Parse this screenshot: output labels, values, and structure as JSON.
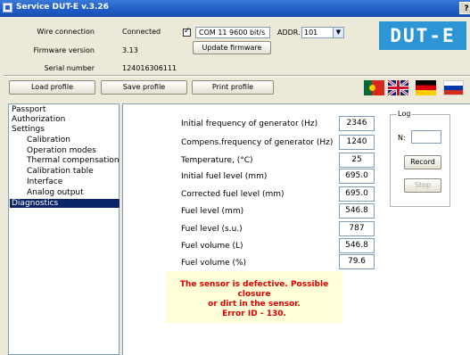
{
  "window": {
    "title": "Service DUT-E  v.3.26",
    "help_label": "?"
  },
  "header": {
    "wire_connection_label": "Wire connection",
    "wire_connection_value": "Connected",
    "firmware_version_label": "Firmware version",
    "firmware_version_value": "3.13",
    "serial_number_label": "Serial number",
    "serial_number_value": "124016306111",
    "com_checked": true,
    "com_value": "COM 11   9600 bit/s",
    "addr_label": "ADDR.",
    "addr_value": "101",
    "update_firmware_label": "Update firmware",
    "logo_text": "DUT-E"
  },
  "toolbar": {
    "load_profile": "Load profile",
    "save_profile": "Save profile",
    "print_profile": "Print profile",
    "flags": [
      "portugal-flag",
      "uk-flag",
      "germany-flag",
      "russia-flag"
    ]
  },
  "sidebar": {
    "items": [
      {
        "label": "Passport",
        "level": 0
      },
      {
        "label": "Authorization",
        "level": 0
      },
      {
        "label": "Settings",
        "level": 0
      },
      {
        "label": "Calibration",
        "level": 1
      },
      {
        "label": "Operation modes",
        "level": 1
      },
      {
        "label": "Thermal compensation",
        "level": 1
      },
      {
        "label": "Calibration table",
        "level": 1
      },
      {
        "label": "Interface",
        "level": 1
      },
      {
        "label": "Analog output",
        "level": 1
      },
      {
        "label": "Diagnostics",
        "level": 0,
        "selected": true
      }
    ]
  },
  "diagnostics": {
    "params": [
      {
        "label": "Initial frequency of generator (Hz)",
        "value": "2346"
      },
      {
        "label": "Compens.frequency of generator (Hz)",
        "value": "1240"
      },
      {
        "label": "Temperature, (°C)",
        "value": "25"
      },
      {
        "label": "Initial fuel level  (mm)",
        "value": "695.0"
      },
      {
        "label": "Corrected fuel level (mm)",
        "value": "695.0"
      },
      {
        "label": "Fuel level (mm)",
        "value": "546.8"
      },
      {
        "label": "Fuel level (s.u.)",
        "value": "787"
      },
      {
        "label": "Fuel volume (L)",
        "value": "546.8"
      },
      {
        "label": "Fuel volume (%)",
        "value": "79.6"
      }
    ],
    "log": {
      "title": "Log",
      "n_label": "N:",
      "n_value": "",
      "record_label": "Record",
      "stop_label": "Stop"
    },
    "warning_lines": [
      "The sensor is defective. Possible closure",
      "or dirt in the sensor.",
      "Error ID - 130."
    ]
  },
  "colors": {
    "titlebar": "#1e5bc6",
    "logo_bg": "#2b95d6",
    "selection": "#0a246a",
    "warning_text": "#e00000",
    "warning_bg": "#ffffd8"
  }
}
